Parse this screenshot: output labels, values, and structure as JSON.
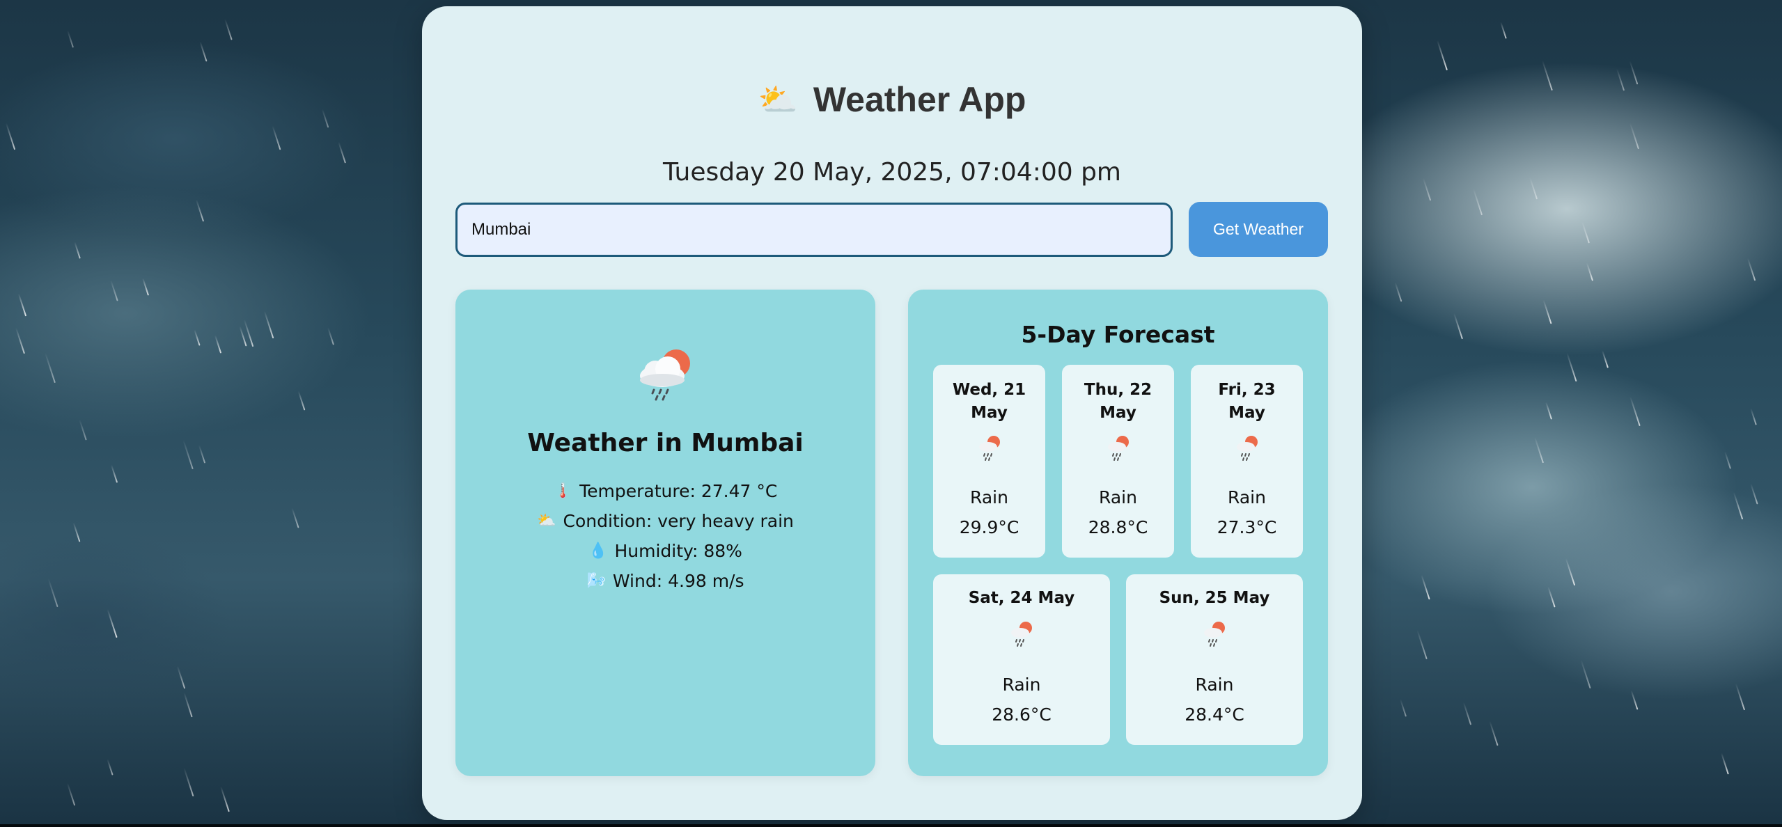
{
  "app": {
    "title": "Weather App",
    "title_icon": "sun-behind-cloud-icon",
    "datetime": "Tuesday 20 May, 2025, 07:04:00 pm"
  },
  "search": {
    "value": "Mumbai",
    "button_label": "Get Weather"
  },
  "current": {
    "icon": "cloud-rain-sun-icon",
    "title": "Weather in Mumbai",
    "temperature": "Temperature: 27.47 °C",
    "condition": "Condition: very heavy rain",
    "humidity": "Humidity: 88%",
    "wind": "Wind: 4.98 m/s"
  },
  "forecast": {
    "title": "5-Day Forecast",
    "days": [
      {
        "date": "Wed, 21 May",
        "condition": "Rain",
        "temp": "29.9°C",
        "icon": "rain-icon"
      },
      {
        "date": "Thu, 22 May",
        "condition": "Rain",
        "temp": "28.8°C",
        "icon": "rain-icon"
      },
      {
        "date": "Fri, 23 May",
        "condition": "Rain",
        "temp": "27.3°C",
        "icon": "rain-icon"
      },
      {
        "date": "Sat, 24 May",
        "condition": "Rain",
        "temp": "28.6°C",
        "icon": "rain-icon"
      },
      {
        "date": "Sun, 25 May",
        "condition": "Rain",
        "temp": "28.4°C",
        "icon": "rain-icon"
      }
    ]
  },
  "colors": {
    "card_bg": "#dff0f3",
    "panel_bg": "#91d9df",
    "button_bg": "#4a96dc",
    "input_border": "#1d5a7a",
    "input_bg": "#e8f0fe",
    "day_card_bg": "#e9f6f8"
  }
}
